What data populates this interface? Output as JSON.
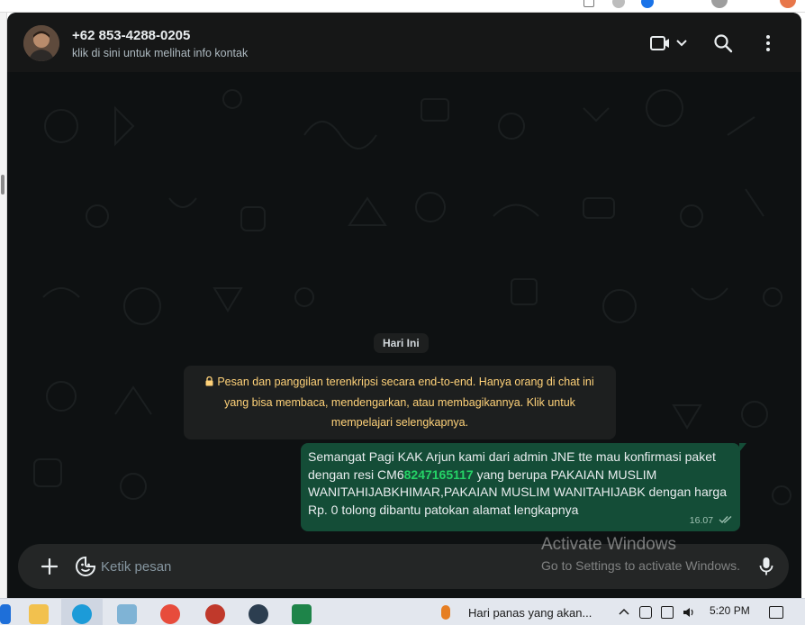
{
  "header": {
    "contact_name": "+62 853-4288-0205",
    "contact_subtitle": "klik di sini untuk melihat info kontak"
  },
  "chat": {
    "date_chip": "Hari Ini",
    "encryption_notice": "Pesan dan panggilan terenkripsi secara end-to-end. Hanya orang di chat ini yang bisa membaca, mendengarkan, atau membagikannya. Klik untuk mempelajari selengkapnya.",
    "message": {
      "text_before": "Semangat Pagi KAK Arjun kami dari admin JNE tte mau konfirmasi paket dengan resi CM6",
      "tracking_number": "8247165117",
      "text_after": " yang berupa PAKAIAN MUSLIM WANITAHIJABKHIMAR,PAKAIAN MUSLIM WANITAHIJABK dengan harga Rp. 0 tolong dibantu patokan alamat lengkapnya",
      "time": "16.07"
    }
  },
  "composer": {
    "placeholder": "Ketik pesan"
  },
  "watermark": {
    "title": "Activate Windows",
    "subtitle": "Go to Settings to activate Windows."
  },
  "taskbar": {
    "weather_text": "Hari panas yang akan...",
    "time": "5:20 PM"
  },
  "colors": {
    "app_bg": "#0b141a",
    "header_bg": "#161717",
    "bubble_outgoing": "#144d37",
    "accent_green": "#25d366",
    "notice_text": "#ffd279"
  },
  "icons": [
    "video-call-icon",
    "chevron-down-icon",
    "search-icon",
    "menu-dots-icon",
    "lock-icon",
    "plus-icon",
    "sticker-icon",
    "microphone-icon",
    "read-receipt-icon"
  ]
}
